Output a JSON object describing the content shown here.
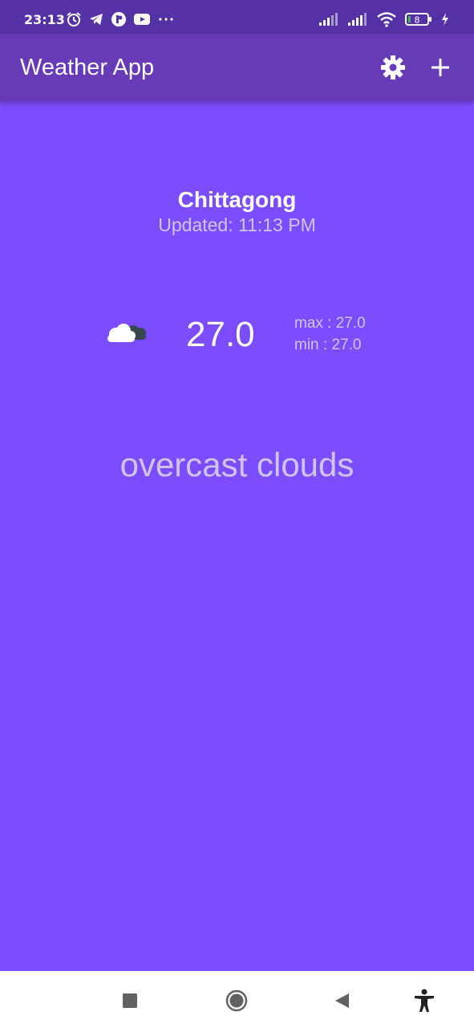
{
  "status_bar": {
    "time": "23:13",
    "battery_level": "8",
    "icons_left": [
      "alarm-icon",
      "telegram-icon",
      "app-icon",
      "youtube-icon",
      "more-dots-icon"
    ],
    "icons_right": [
      "signal-icon",
      "signal-icon",
      "wifi-icon",
      "battery-icon",
      "charging-icon"
    ]
  },
  "app_bar": {
    "title": "Weather App",
    "actions": [
      "settings-icon",
      "add-icon"
    ]
  },
  "weather": {
    "city": "Chittagong",
    "updated": "Updated: 11:13 PM",
    "temperature": "27.0",
    "max": "max : 27.0",
    "min": "min : 27.0",
    "description": "overcast clouds",
    "icon": "overcast-clouds-icon"
  },
  "nav_bar": {
    "buttons": [
      "recents-icon",
      "home-icon",
      "back-icon",
      "accessibility-icon"
    ]
  },
  "colors": {
    "status_bar": "#5531a6",
    "app_bar": "#673ab7",
    "background": "#7c4dff",
    "secondary_text": "#d1c4e9",
    "nav_bar": "#ffffff"
  }
}
